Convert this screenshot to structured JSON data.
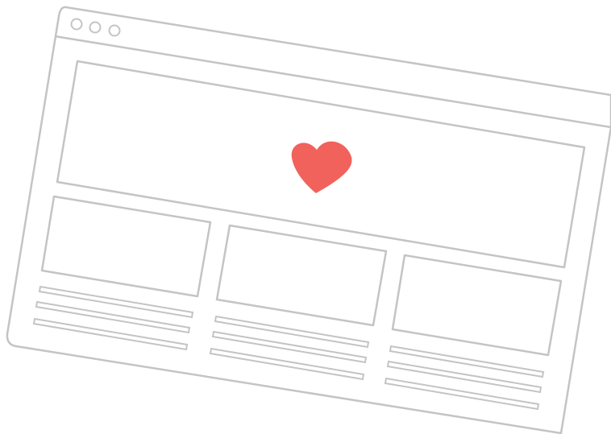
{
  "illustration": {
    "window_controls": [
      "close-dot",
      "minimize-dot",
      "maximize-dot"
    ],
    "hero": {
      "icon": "heart-icon"
    },
    "cards": [
      {
        "text_lines": 3
      },
      {
        "text_lines": 3
      },
      {
        "text_lines": 3
      }
    ]
  },
  "colors": {
    "outline": "#c4c4c4",
    "heart": "#f0625b",
    "background": "#ffffff"
  }
}
